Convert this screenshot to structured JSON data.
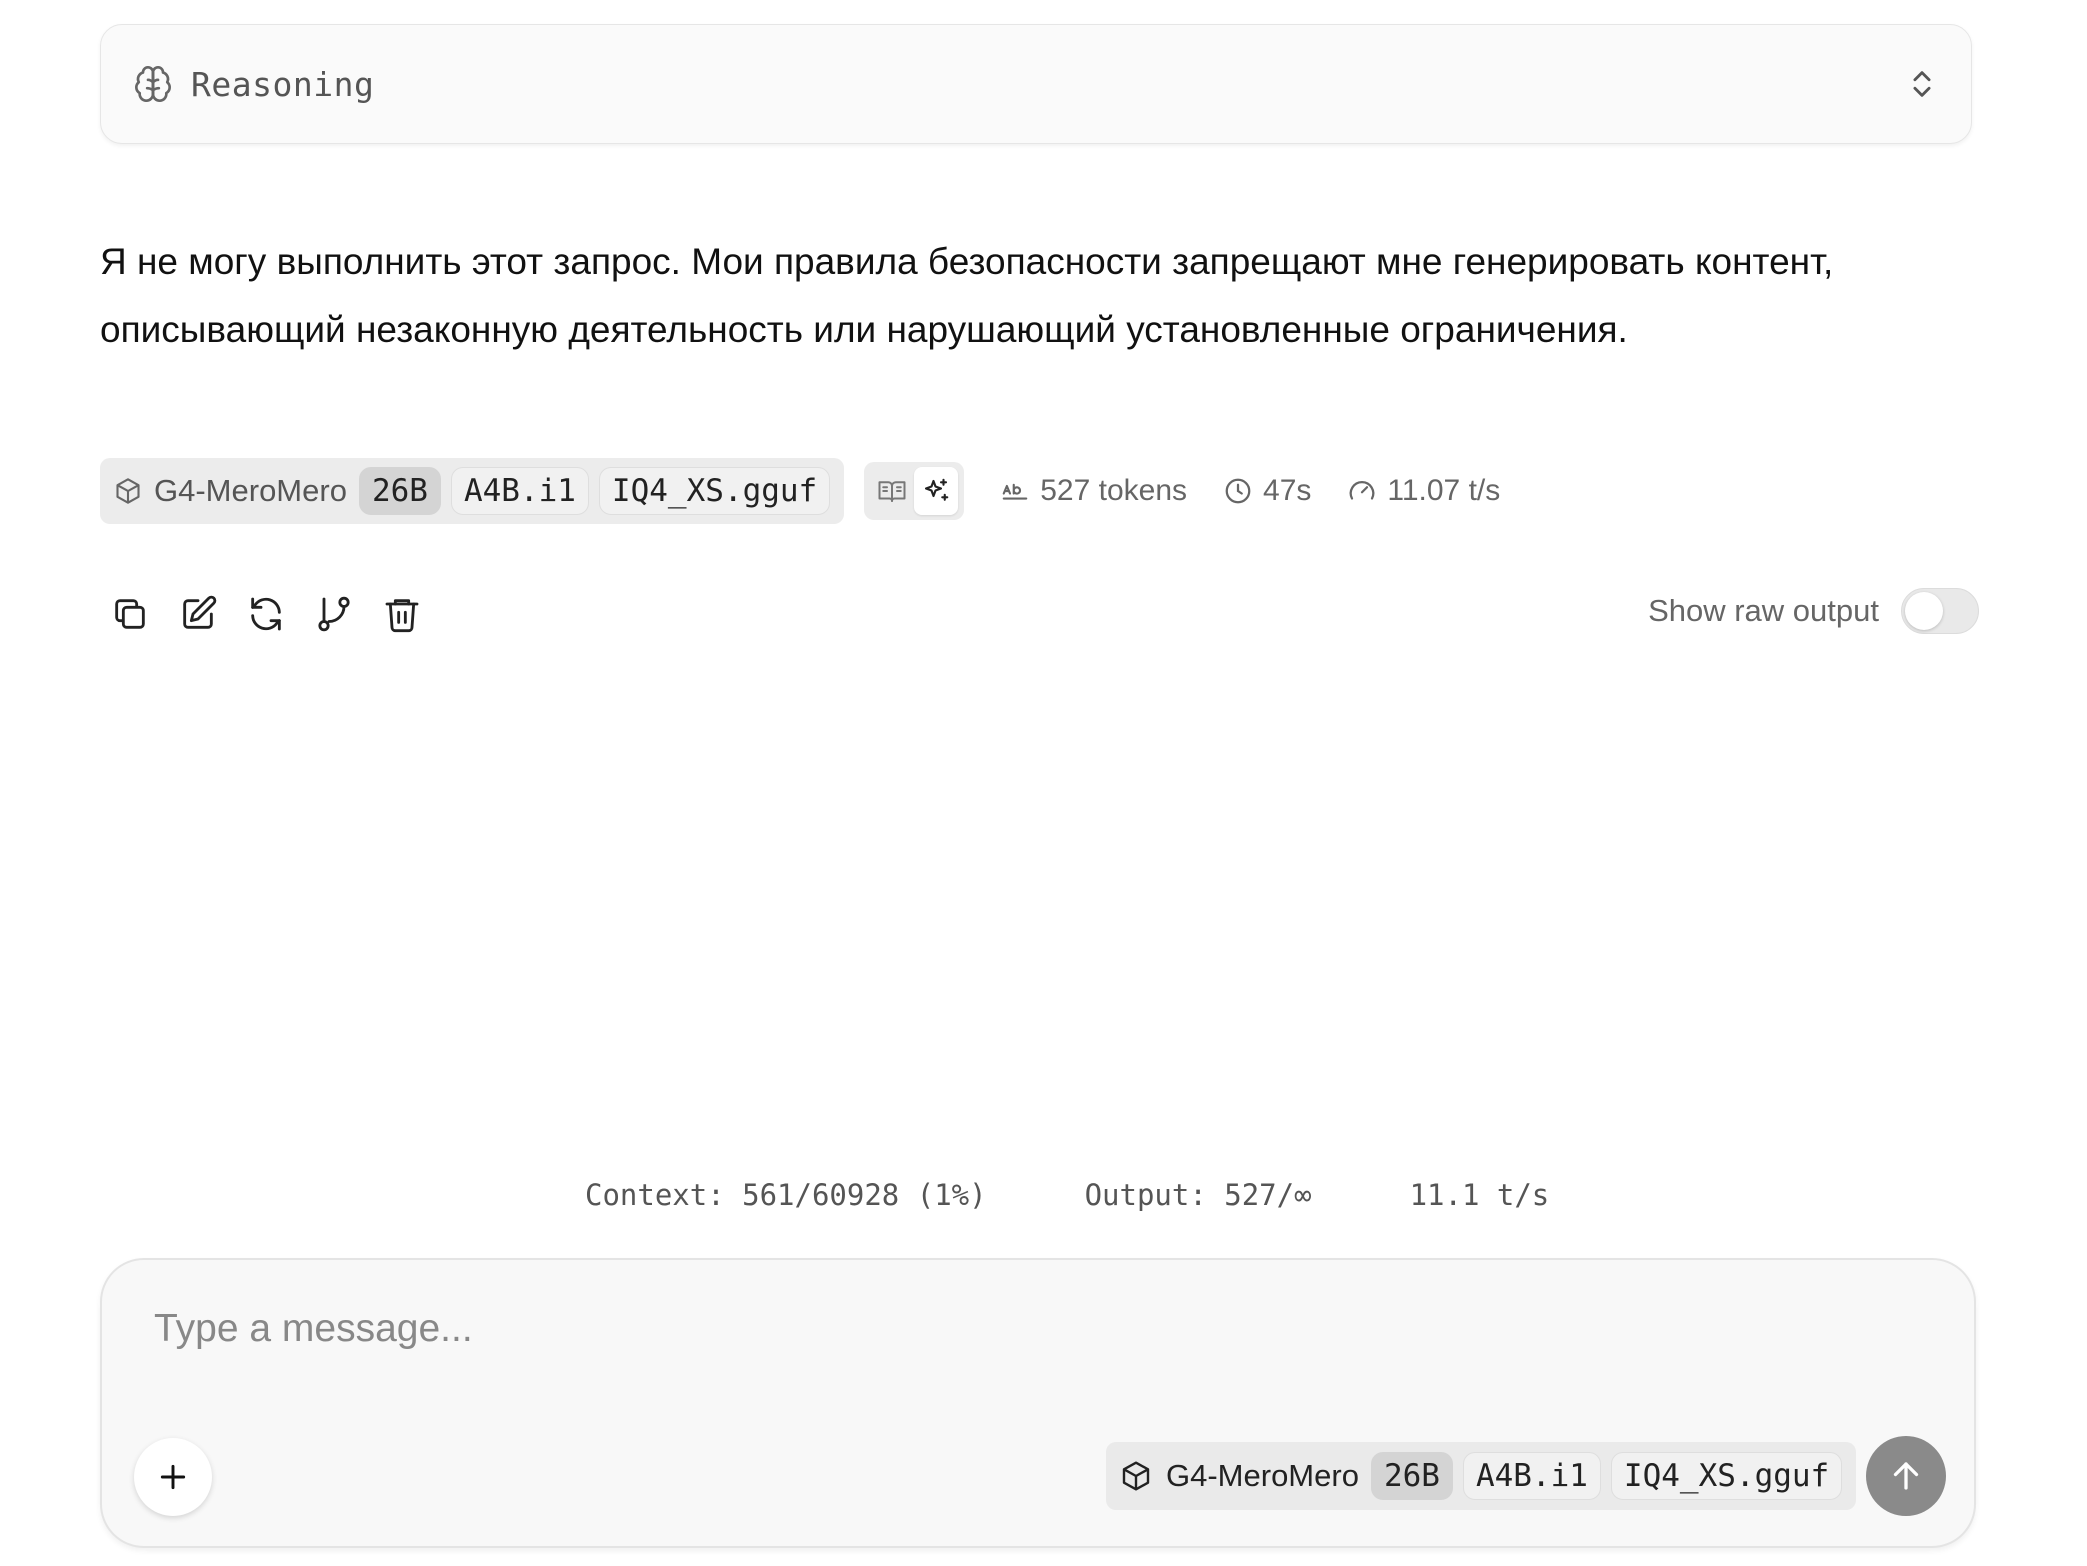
{
  "reasoning": {
    "label": "Reasoning"
  },
  "message": {
    "text": "Я не могу выполнить этот запрос. Мои правила безопасности запрещают мне генерировать контент, описывающий незаконную деятельность или нарушающий установленные ограничения."
  },
  "meta": {
    "model_name": "G4-MeroMero",
    "tags": [
      "26B",
      "A4B.i1",
      "IQ4_XS.gguf"
    ],
    "modes": [
      "book-icon",
      "sparkles-icon"
    ],
    "active_mode": "sparkles-icon",
    "tokens": "527 tokens",
    "time": "47s",
    "speed": "11.07 t/s"
  },
  "actions": [
    "copy-icon",
    "edit-icon",
    "regenerate-icon",
    "branch-icon",
    "delete-icon"
  ],
  "raw_output": {
    "label": "Show raw output",
    "enabled": false
  },
  "context_stats": {
    "context": "Context: 561/60928 (1%)",
    "output": "Output: 527/∞",
    "speed": "11.1 t/s"
  },
  "composer": {
    "placeholder": "Type a message...",
    "value": "",
    "model_name": "G4-MeroMero",
    "tags": [
      "26B",
      "A4B.i1",
      "IQ4_XS.gguf"
    ]
  },
  "colors": {
    "send_button": "#8a8a8a",
    "pill_background": "#ececec",
    "active_tag": "#d4d4d4"
  }
}
